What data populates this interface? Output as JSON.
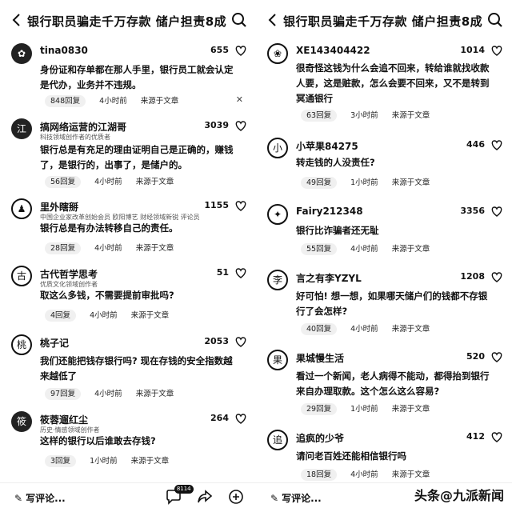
{
  "header": {
    "title": "银行职员骗走千万存款 储户担责8成"
  },
  "footer": {
    "write_label": "写评论...",
    "comment_badge": "8114",
    "watermark": "头条@九派新闻"
  },
  "left_comments": [
    {
      "name": "tina0830",
      "sub": "",
      "likes": "655",
      "text": "身份证和存单都在那人手里，银行员工就会认定是代办，业务并不违规。",
      "replies": "848回复",
      "time": "4小时前",
      "source": "来源于文章"
    },
    {
      "name": "搞网络运营的江湖哥",
      "sub": "科技领域创作者的优质者",
      "likes": "3039",
      "text": "银行总是有充足的理由证明自己是正确的，赚钱了，是银行的，出事了，是储户的。",
      "replies": "56回复",
      "time": "4小时前",
      "source": "来源于文章"
    },
    {
      "name": "里外瞎掰",
      "sub": "中国企业家改革创始会员 欧阳博艺 财经领域新锐 评论员",
      "likes": "1155",
      "text": "银行总是有办法转移自己的责任。",
      "replies": "28回复",
      "time": "4小时前",
      "source": "来源于文章"
    },
    {
      "name": "古代哲学思考",
      "sub": "优质文化领域创作者",
      "likes": "51",
      "text": "取这么多钱，不需要提前审批吗?",
      "replies": "4回复",
      "time": "4小时前",
      "source": "来源于文章"
    },
    {
      "name": "桃子记",
      "sub": "",
      "likes": "2053",
      "text": "我们还能把钱存银行吗? 现在存钱的安全指数越来越低了",
      "replies": "97回复",
      "time": "4小时前",
      "source": "来源于文章"
    },
    {
      "name": "筱蓉遛红尘",
      "sub": "历史·情感领域创作者",
      "likes": "264",
      "text": "这样的银行以后谁敢去存钱?",
      "replies": "3回复",
      "time": "1小时前",
      "source": "来源于文章"
    }
  ],
  "right_comments": [
    {
      "name": "XE143404422",
      "sub": "",
      "likes": "1014",
      "text": "很奇怪这钱为什么会追不回来，转给谁就找收款人要，这是赃款，怎么会要不回来，又不是转到冥通银行",
      "replies": "63回复",
      "time": "3小时前",
      "source": "来源于文章"
    },
    {
      "name": "小苹果84275",
      "sub": "",
      "likes": "446",
      "text": "转走钱的人没责任?",
      "replies": "49回复",
      "time": "1小时前",
      "source": "来源于文章"
    },
    {
      "name": "Fairy212348",
      "sub": "",
      "likes": "3356",
      "text": "银行比诈骗者还无耻",
      "replies": "55回复",
      "time": "4小时前",
      "source": "来源于文章"
    },
    {
      "name": "言之有李YZYL",
      "sub": "",
      "likes": "1208",
      "text": "好可怕! 想一想，如果哪天储户们的钱都不存银行了会怎样?",
      "replies": "40回复",
      "time": "4小时前",
      "source": "来源于文章"
    },
    {
      "name": "果城慢生活",
      "sub": "",
      "likes": "520",
      "text": "看过一个新闻，老人病得不能动，都得抬到银行来自办理取款。这个怎么这么容易?",
      "replies": "29回复",
      "time": "1小时前",
      "source": "来源于文章"
    },
    {
      "name": "追疯的少爷",
      "sub": "",
      "likes": "412",
      "text": "请问老百姓还能相信银行吗",
      "replies": "18回复",
      "time": "4小时前",
      "source": "来源于文章"
    }
  ]
}
